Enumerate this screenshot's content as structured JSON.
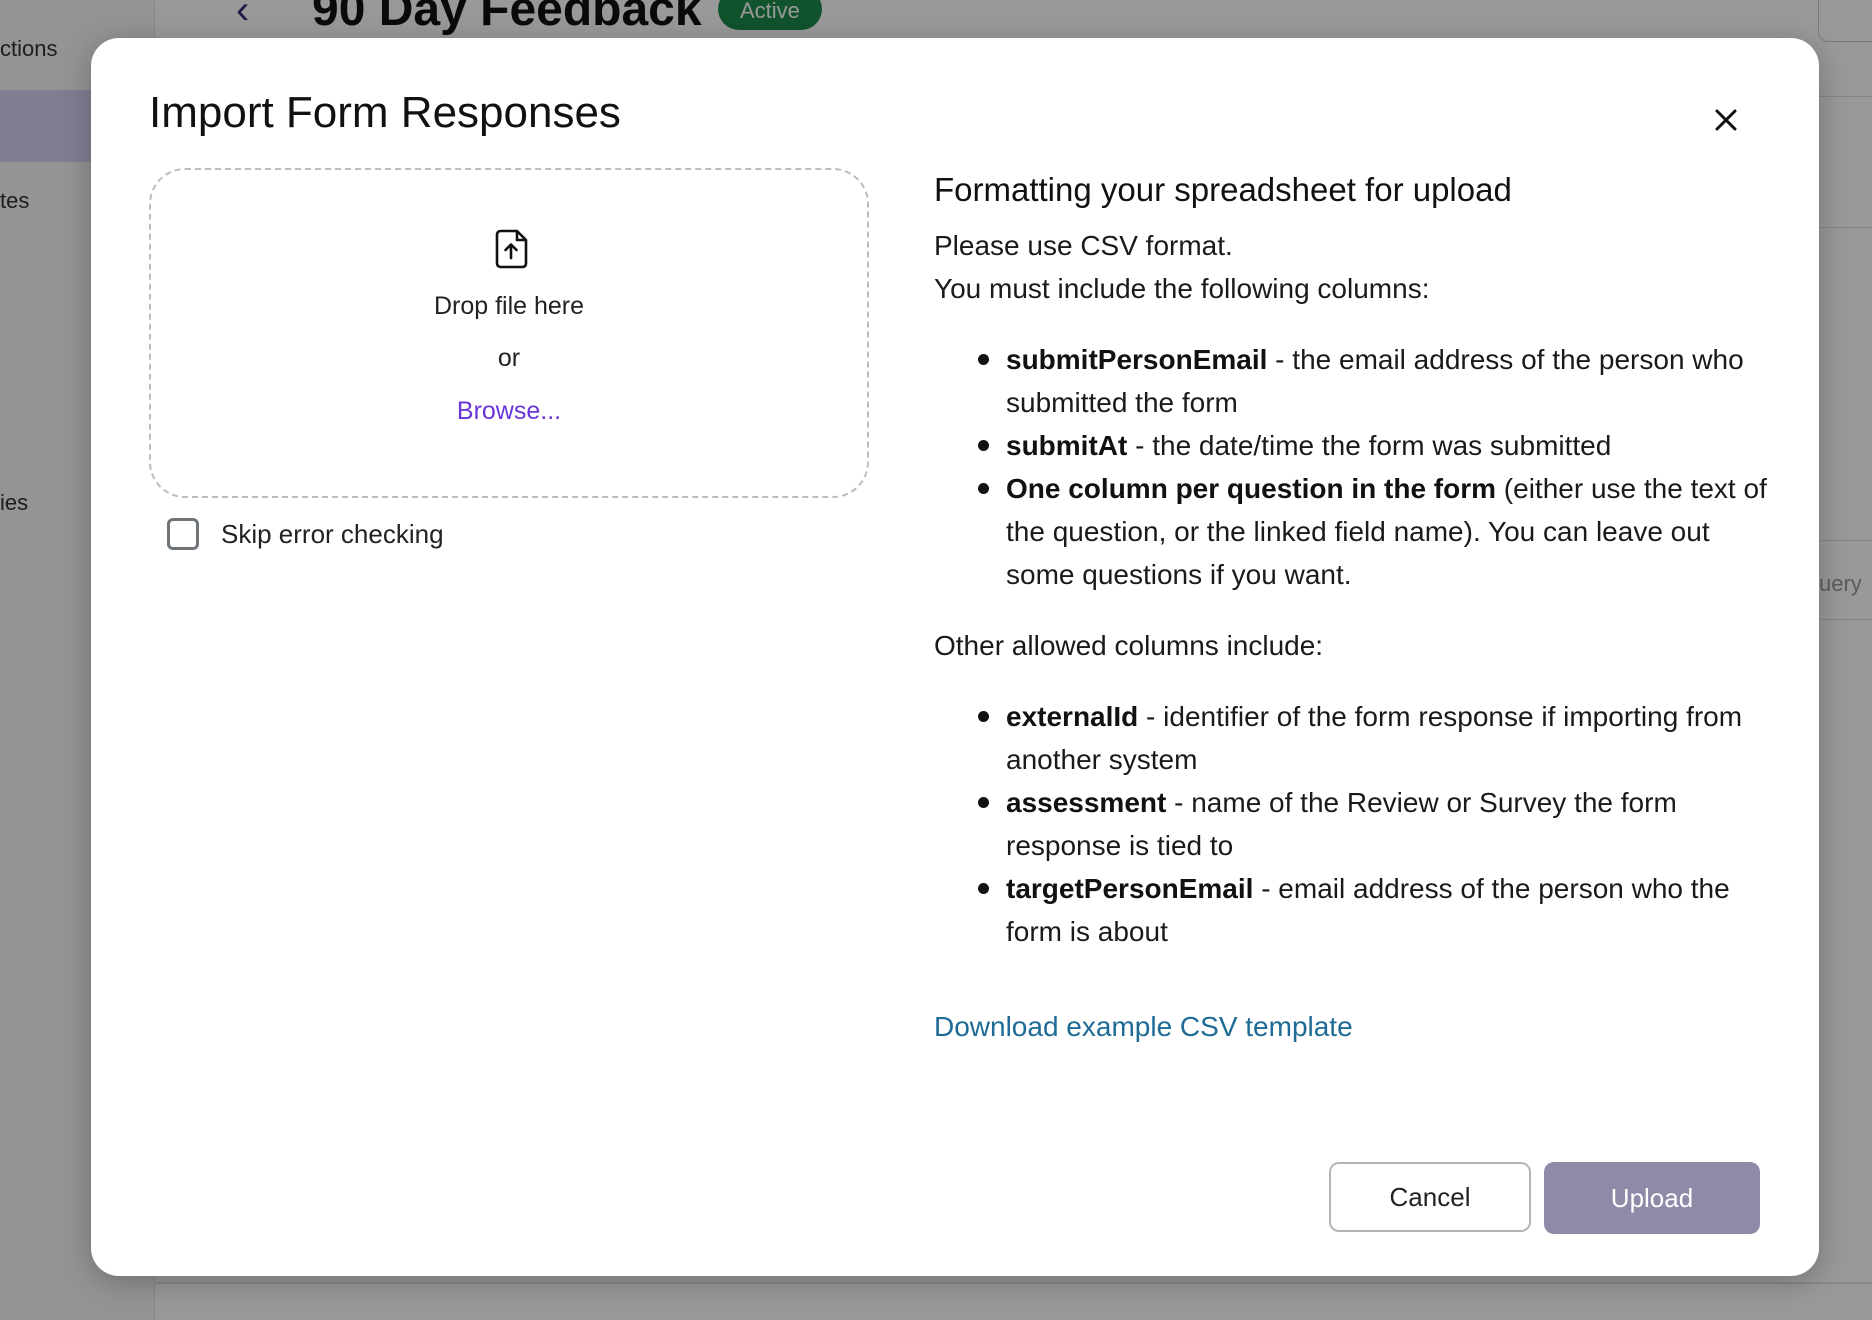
{
  "background": {
    "sidebar_items": [
      "ctions",
      "tes",
      "ies"
    ],
    "page_title": "90 Day Feedback",
    "status_badge": "Active",
    "query_partial": "uery"
  },
  "modal": {
    "title": "Import Form Responses",
    "close_icon": "close-icon",
    "dropzone": {
      "icon": "file-upload-icon",
      "drop_text": "Drop file here",
      "or_text": "or",
      "browse_label": "Browse..."
    },
    "skip_error_checking": {
      "label": "Skip error checking",
      "checked": false
    },
    "info": {
      "heading": "Formatting your spreadsheet for upload",
      "line1": "Please use CSV format.",
      "line2": "You must include the following columns:",
      "required_columns": [
        {
          "name": "submitPersonEmail",
          "desc": " - the email address of the person who submitted the form"
        },
        {
          "name": "submitAt",
          "desc": " - the date/time the form was submitted"
        },
        {
          "name": "One column per question in the form",
          "desc": " (either use the text of the question, or the linked field name). You can leave out some questions if you want."
        }
      ],
      "other_intro": "Other allowed columns include:",
      "optional_columns": [
        {
          "name": "externalId",
          "desc": " - identifier of the form response if importing from another system"
        },
        {
          "name": "assessment",
          "desc": " - name of the Review or Survey the form response is tied to"
        },
        {
          "name": "targetPersonEmail",
          "desc": " - email address of the person who the form is about"
        }
      ],
      "download_link": "Download example CSV template"
    },
    "footer": {
      "cancel_label": "Cancel",
      "upload_label": "Upload"
    }
  },
  "colors": {
    "accent_link": "#6a35d8",
    "download_link": "#1e6b96",
    "upload_button": "#8f8aa8",
    "status_active": "#1b8a4c"
  }
}
